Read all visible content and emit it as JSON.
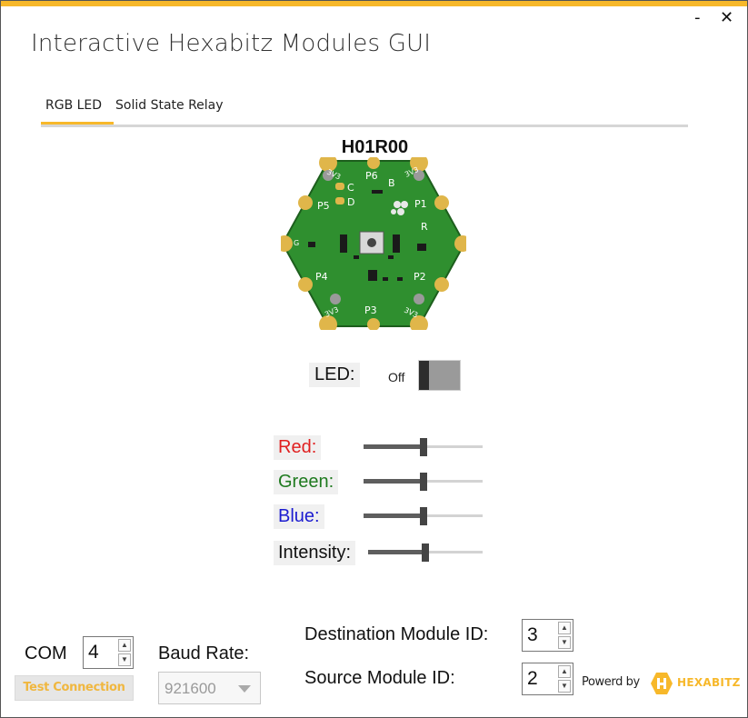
{
  "window": {
    "title": "Interactive Hexabitz Modules GUI",
    "minimize_label": "-",
    "close_label": "✕"
  },
  "tabs": [
    {
      "label": "RGB LED",
      "active": true
    },
    {
      "label": "Solid State Relay",
      "active": false
    }
  ],
  "module": {
    "name": "H01R00",
    "pcb_labels": [
      "3V3",
      "P6",
      "B",
      "3V3",
      "C",
      "D",
      "P5",
      "P1",
      "R",
      "G",
      "P4",
      "P2",
      "3V3",
      "P3",
      "3V3"
    ]
  },
  "led": {
    "label": "LED:",
    "state_label": "Off",
    "state": "off"
  },
  "sliders": [
    {
      "label": "Red:",
      "color": "#e02020",
      "value": 0.5
    },
    {
      "label": "Green:",
      "color": "#1f7a1f",
      "value": 0.5
    },
    {
      "label": "Blue:",
      "color": "#1c1cd0",
      "value": 0.5
    },
    {
      "label": "Intensity:",
      "color": "#111111",
      "value": 0.5
    }
  ],
  "connection": {
    "com_label": "COM",
    "com_value": "4",
    "test_button": "Test Connection",
    "baud_label": "Baud Rate:",
    "baud_value": "921600",
    "dest_label": "Destination Module ID:",
    "dest_value": "3",
    "source_label": "Source Module ID:",
    "source_value": "2"
  },
  "footer": {
    "powered_by": "Powerd by",
    "brand": "HEXABITZ"
  },
  "colors": {
    "accent": "#f7b82a",
    "pcb_green": "#2e8b2e",
    "pad_gold": "#e0b64a"
  }
}
